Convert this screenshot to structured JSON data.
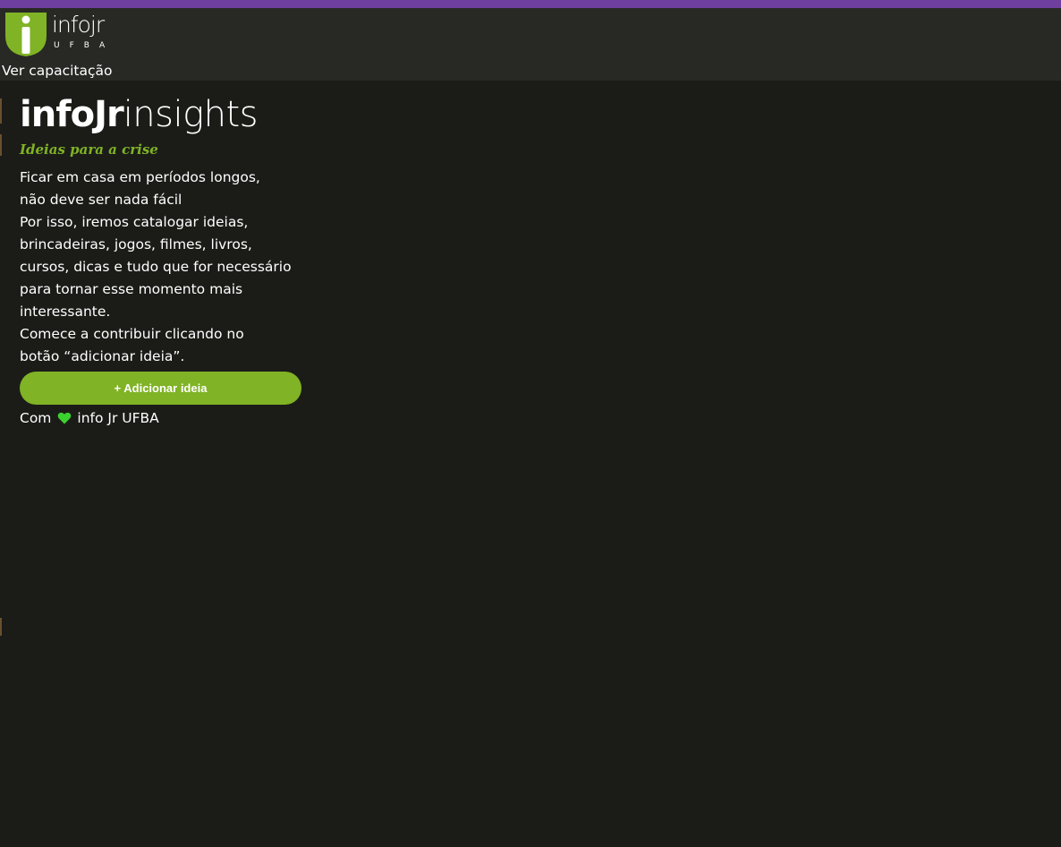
{
  "colors": {
    "accent_purple": "#6f3fa0",
    "brand_green": "#80b325",
    "heart_green": "#3bd12f",
    "header_bg": "#282925",
    "page_bg": "#1b1c18"
  },
  "header": {
    "logo": {
      "icon": "info-logo-icon",
      "wordmark": "infojr",
      "sub": "UFBA"
    },
    "nav_link": "Ver capacitação"
  },
  "main": {
    "brand_bold": "infoJr",
    "brand_light": "insights",
    "tagline": "Ideias para a crise",
    "intro_lines": [
      "Ficar em casa em períodos longos,",
      "não deve ser nada fácil",
      "Por isso, iremos catalogar ideias,",
      "brincadeiras, jogos, filmes, livros,",
      "cursos, dicas e tudo que for necessário",
      "para tornar esse momento mais",
      "interessante.",
      "Comece a contribuir clicando no",
      "botão “adicionar ideia”."
    ],
    "add_button": "+ Adicionar ideia",
    "footer": {
      "prefix": "Com",
      "icon": "heart-icon",
      "suffix": "info Jr UFBA"
    }
  }
}
